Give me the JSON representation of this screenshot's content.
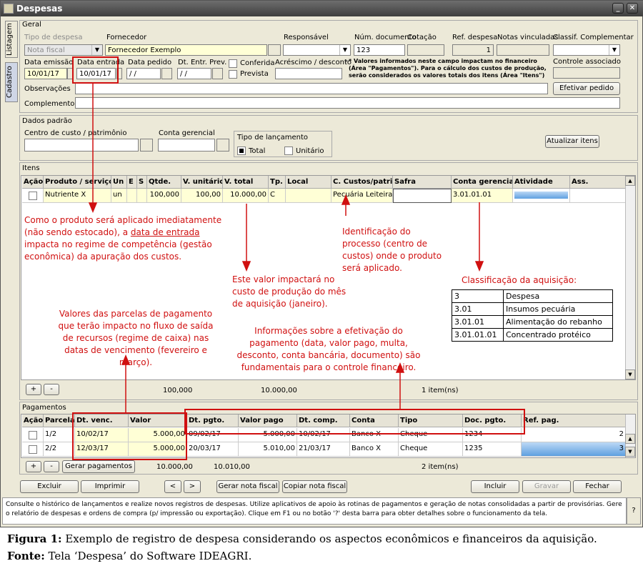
{
  "window": {
    "title": "Despesas"
  },
  "side_tabs": [
    "Listagem",
    "Cadastro"
  ],
  "geral": {
    "header": "Geral",
    "tipo_despesa_label": "Tipo de despesa",
    "tipo_despesa_value": "Nota fiscal",
    "fornecedor_label": "Fornecedor",
    "fornecedor_value": "Fornecedor Exemplo",
    "responsavel_label": "Responsável",
    "num_doc_label": "Núm. documento",
    "num_doc_value": "123",
    "cotacao_label": "Cotação",
    "ref_despesa_label": "Ref. despesa",
    "ref_despesa_value": "1",
    "notas_vinc_label": "Notas vinculadas",
    "classif_label": "Classif. Complementar",
    "data_emissao_label": "Data emissão",
    "data_emissao_value": "10/01/17",
    "data_entrada_label": "Data entrada",
    "data_entrada_value": "10/01/17",
    "data_pedido_label": "Data pedido",
    "data_pedido_value": "/ /",
    "dt_entr_prev_label": "Dt. Entr. Prev.",
    "dt_entr_prev_value": "/ /",
    "conferida_label": "Conferida",
    "prevista_label": "Prevista",
    "acrescimo_label": "Acréscimo / desconto",
    "note": "* Valores informados neste campo impactam no financeiro (Área \"Pagamentos\"). Para o cálculo dos custos de produção, serão considerados os valores totais dos itens (Área \"Itens\")",
    "controle_label": "Controle associado",
    "observacoes_label": "Observações",
    "complemento_label": "Complemento",
    "efetivar_btn": "Efetivar pedido"
  },
  "dados": {
    "header": "Dados padrão",
    "centro_label": "Centro de custo / patrimônio",
    "conta_label": "Conta gerencial",
    "tipo_lanc_label": "Tipo de lançamento",
    "total_label": "Total",
    "unitario_label": "Unitário",
    "atualizar_btn": "Atualizar itens"
  },
  "itens": {
    "header": "Itens",
    "columns": [
      "Ação",
      "Produto / serviço",
      "Un",
      "E",
      "S",
      "Qtde.",
      "V. unitário",
      "V. total",
      "Tp.",
      "Local",
      "C. Custos/patrin",
      "Safra",
      "Conta gerencial",
      "Atividade",
      "Ass."
    ],
    "row": {
      "produto": "Nutriente X",
      "un": "un",
      "qtde": "100,000",
      "v_unit": "100,00",
      "v_total": "10.000,00",
      "tp": "C",
      "ccustos": "Pecuária  Leiteira[",
      "conta": "3.01.01.01"
    },
    "footer_qtde": "100,000",
    "footer_total": "10.000,00",
    "footer_count": "1  item(ns)",
    "plus": "+",
    "minus": "-"
  },
  "pagamentos": {
    "header": "Pagamentos",
    "columns": [
      "Ação",
      "Parcela",
      "Dt. venc.",
      "Valor",
      "Dt. pgto.",
      "Valor pago",
      "Dt. comp.",
      "Conta",
      "Tipo",
      "Doc. pgto.",
      "Ref. pag."
    ],
    "rows": [
      {
        "parcela": "1/2",
        "dt_venc": "10/02/17",
        "valor": "5.000,00",
        "dt_pgto": "09/02/17",
        "valor_pago": "5.000,00",
        "dt_comp": "10/02/17",
        "conta": "Banco X",
        "tipo": "Cheque",
        "doc": "1234",
        "ref": "2"
      },
      {
        "parcela": "2/2",
        "dt_venc": "12/03/17",
        "valor": "5.000,00",
        "dt_pgto": "20/03/17",
        "valor_pago": "5.010,00",
        "dt_comp": "21/03/17",
        "conta": "Banco X",
        "tipo": "Cheque",
        "doc": "1235",
        "ref": "3"
      }
    ],
    "gerar_btn": "Gerar pagamentos",
    "footer_valor": "10.000,00",
    "footer_pago": "10.010,00",
    "footer_count": "2  item(ns)"
  },
  "bottom": {
    "excluir": "Excluir",
    "imprimir": "Imprimir",
    "prev": "<",
    "next": ">",
    "gerar_nota": "Gerar nota fiscal",
    "copiar_nota": "Copiar nota fiscal",
    "incluir": "Incluir",
    "gravar": "Gravar",
    "fechar": "Fechar"
  },
  "hint": "Consulte o histórico de lançamentos e realize novos registros de despesas. Utilize aplicativos de apoio às rotinas de pagamentos e geração de notas consolidadas a partir de provisórias. Gere o relatório de despesas e ordens de compra (p/ impressão ou exportação). Clique em F1 ou no botão '?' desta barra para obter detalhes sobre o funcionamento da tela.",
  "hint_q": "?",
  "annotations": {
    "a1": "Como o produto será aplicado imediatamente (não sendo estocado), a ",
    "a1_u": "data de entrada",
    "a1_b": " impacta no regime de competência (gestão econômica) da apuração dos custos.",
    "a2": "Identificação do processo (centro de custos) onde o produto será aplicado.",
    "a3": "Este valor impactará no custo de produção do mês de aquisição (janeiro).",
    "a4": "Classificação da aquisição:",
    "a5": "Valores das parcelas de pagamento que terão impacto no fluxo de saída de recursos (regime de caixa) nas datas de vencimento (fevereiro e março).",
    "a6": "Informações sobre a efetivação do pagamento (data, valor pago, multa, desconto, conta bancária, documento) são fundamentais para o controle financeiro.",
    "classif_table": [
      [
        "3",
        "Despesa"
      ],
      [
        "3.01",
        "Insumos pecuária"
      ],
      [
        "3.01.01",
        "Alimentação do rebanho"
      ],
      [
        "3.01.01.01",
        "Concentrado protéico"
      ]
    ]
  },
  "caption": {
    "fig_bold": "Figura 1:",
    "fig_text": " Exemplo de registro de despesa considerando os aspectos econômicos e financeiros da aquisição.",
    "src_bold": "Fonte:",
    "src_text": " Tela ‘Despesa’ do Software IDEAGRI."
  },
  "colors": {
    "annotation": "#d01010",
    "title_bar": "#4a4a4a",
    "highlight": "#ffffd6"
  }
}
